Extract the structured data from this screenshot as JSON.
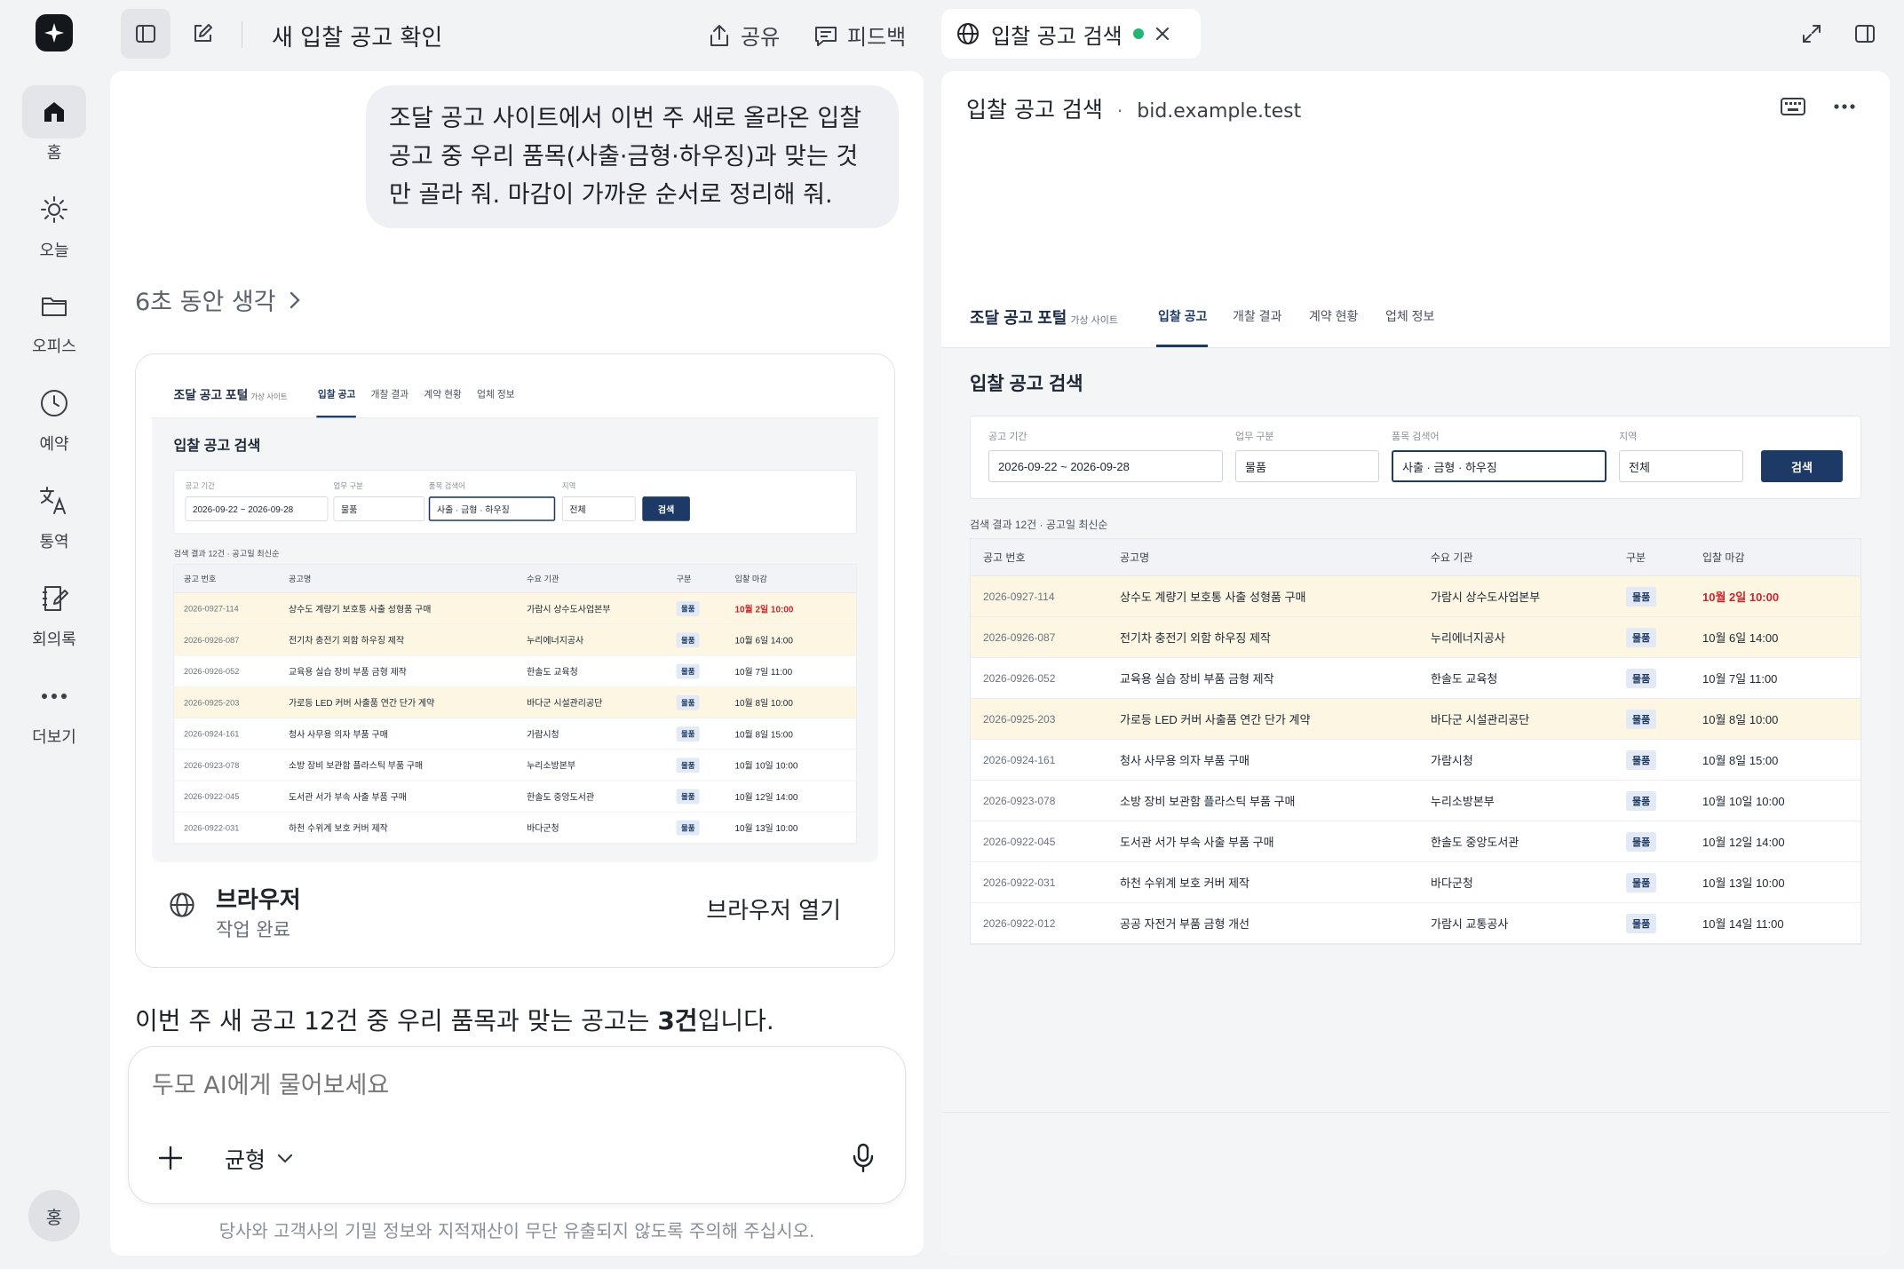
{
  "sidebar": {
    "items": [
      {
        "label": "홈"
      },
      {
        "label": "오늘"
      },
      {
        "label": "오피스"
      },
      {
        "label": "예약"
      },
      {
        "label": "통역"
      },
      {
        "label": "회의록"
      },
      {
        "label": "더보기"
      }
    ],
    "avatar": "홍"
  },
  "topbar": {
    "title": "새 입찰 공고 확인",
    "share": "공유",
    "feedback": "피드백",
    "browser_tab": "입찰 공고 검색"
  },
  "chat": {
    "user_message": "조달 공고 사이트에서 이번 주 새로 올라온 입찰 공고 중 우리 품목(사출·금형·하우징)과 맞는 것만 골라 줘. 마감이 가까운 순서로 정리해 줘.",
    "thinking": "6초 동안 생각",
    "card_title": "브라우저",
    "card_status": "작업 완료",
    "card_open": "브라우저 열기",
    "answer_prefix": "이번 주 새 공고 12건 중 우리 품목과 맞는 공고는 ",
    "answer_bold": "3건",
    "answer_suffix": "입니다.",
    "input_placeholder": "두모 AI에게 물어보세요",
    "mode": "균형",
    "disclaimer": "당사와 고객사의 기밀 정보와 지적재산이 무단 유출되지 않도록 주의해 주십시오."
  },
  "browser": {
    "title": "입찰 공고 검색",
    "url": "bid.example.test",
    "colors": {
      "accent": "#1d3a66",
      "highlight": "#fdf6e3",
      "due_urgent": "#c8252c",
      "status_dot": "#22b573"
    }
  },
  "portal": {
    "brand": "조달 공고 포털",
    "brand_note": "가상 사이트",
    "tabs": [
      "입찰 공고",
      "개찰 결과",
      "계약 현황",
      "업체 정보"
    ],
    "heading": "입찰 공고 검색",
    "form": {
      "period_label": "공고 기간",
      "period_value": "2026-09-22 ~ 2026-09-28",
      "type_label": "업무 구분",
      "type_value": "물품",
      "keyword_label": "품목 검색어",
      "keyword_value": "사출 · 금형 · 하우징",
      "region_label": "지역",
      "region_value": "전체",
      "search_button": "검색"
    },
    "result_count": "검색 결과 12건 · 공고일 최신순",
    "columns": [
      "공고 번호",
      "공고명",
      "수요 기관",
      "구분",
      "입찰 마감"
    ],
    "rows": [
      {
        "no": "2026-0927-114",
        "name": "상수도 계량기 보호통 사출 성형품 구매",
        "org": "가람시 상수도사업본부",
        "type": "물품",
        "due": "10월 2일 10:00"
      },
      {
        "no": "2026-0926-087",
        "name": "전기차 충전기 외함 하우징 제작",
        "org": "누리에너지공사",
        "type": "물품",
        "due": "10월 6일 14:00"
      },
      {
        "no": "2026-0926-052",
        "name": "교육용 실습 장비 부품 금형 제작",
        "org": "한솔도 교육청",
        "type": "물품",
        "due": "10월 7일 11:00"
      },
      {
        "no": "2026-0925-203",
        "name": "가로등 LED 커버 사출품 연간 단가 계약",
        "org": "바다군 시설관리공단",
        "type": "물품",
        "due": "10월 8일 10:00"
      },
      {
        "no": "2026-0924-161",
        "name": "청사 사무용 의자 부품 구매",
        "org": "가람시청",
        "type": "물품",
        "due": "10월 8일 15:00"
      },
      {
        "no": "2026-0923-078",
        "name": "소방 장비 보관함 플라스틱 부품 구매",
        "org": "누리소방본부",
        "type": "물품",
        "due": "10월 10일 10:00"
      },
      {
        "no": "2026-0922-045",
        "name": "도서관 서가 부속 사출 부품 구매",
        "org": "한솔도 중앙도서관",
        "type": "물품",
        "due": "10월 12일 14:00"
      },
      {
        "no": "2026-0922-031",
        "name": "하천 수위계 보호 커버 제작",
        "org": "바다군청",
        "type": "물품",
        "due": "10월 13일 10:00"
      },
      {
        "no": "2026-0922-012",
        "name": "공공 자전거 부품 금형 개선",
        "org": "가람시 교통공사",
        "type": "물품",
        "due": "10월 14일 11:00"
      }
    ],
    "highlighted_rows": [
      0,
      1,
      3
    ]
  }
}
